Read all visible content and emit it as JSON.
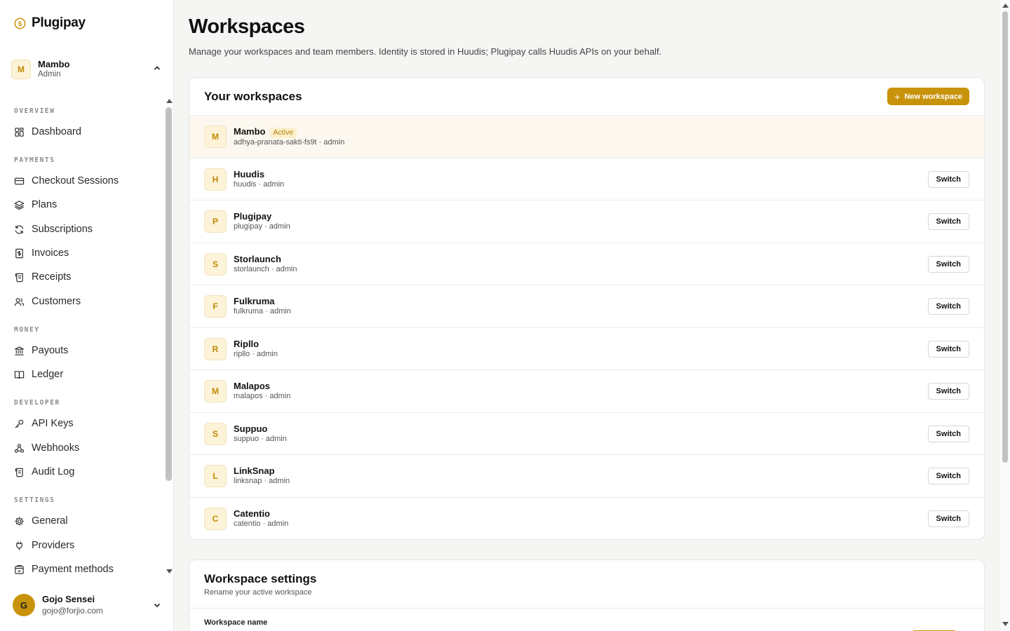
{
  "brand": {
    "name": "Plugipay",
    "accent": "#c8930a"
  },
  "workspace_switcher": {
    "initial": "M",
    "name": "Mambo",
    "role": "Admin"
  },
  "nav": {
    "sections": [
      {
        "label": "OVERVIEW",
        "items": [
          {
            "label": "Dashboard",
            "icon": "grid-icon"
          }
        ]
      },
      {
        "label": "PAYMENTS",
        "items": [
          {
            "label": "Checkout Sessions",
            "icon": "credit-card-icon"
          },
          {
            "label": "Plans",
            "icon": "layers-icon"
          },
          {
            "label": "Subscriptions",
            "icon": "refresh-icon"
          },
          {
            "label": "Invoices",
            "icon": "invoice-dollar-icon"
          },
          {
            "label": "Receipts",
            "icon": "scroll-icon"
          },
          {
            "label": "Customers",
            "icon": "users-icon"
          }
        ]
      },
      {
        "label": "MONEY",
        "items": [
          {
            "label": "Payouts",
            "icon": "bank-icon"
          },
          {
            "label": "Ledger",
            "icon": "book-icon"
          }
        ]
      },
      {
        "label": "DEVELOPER",
        "items": [
          {
            "label": "API Keys",
            "icon": "key-icon"
          },
          {
            "label": "Webhooks",
            "icon": "webhook-icon"
          },
          {
            "label": "Audit Log",
            "icon": "scroll-icon"
          }
        ]
      },
      {
        "label": "SETTINGS",
        "items": [
          {
            "label": "General",
            "icon": "gear-icon"
          },
          {
            "label": "Providers",
            "icon": "plug-icon"
          },
          {
            "label": "Payment methods",
            "icon": "wallet-icon"
          }
        ]
      }
    ]
  },
  "user": {
    "initial": "G",
    "name": "Gojo Sensei",
    "email": "gojo@forjio.com"
  },
  "header": {
    "title": "Workspaces",
    "subtitle": "Manage your workspaces and team members. Identity is stored in Huudis; Plugipay calls Huudis APIs on your behalf."
  },
  "workspaces_card": {
    "title": "Your workspaces",
    "new_button_label": "New workspace",
    "active_badge": "Active",
    "switch_label": "Switch",
    "rows": [
      {
        "initial": "M",
        "name": "Mambo",
        "meta": "adhya-pranata-sakti-fs9t · admin",
        "active": true
      },
      {
        "initial": "H",
        "name": "Huudis",
        "meta": "huudis · admin",
        "active": false
      },
      {
        "initial": "P",
        "name": "Plugipay",
        "meta": "plugipay · admin",
        "active": false
      },
      {
        "initial": "S",
        "name": "Storlaunch",
        "meta": "storlaunch · admin",
        "active": false
      },
      {
        "initial": "F",
        "name": "Fulkruma",
        "meta": "fulkruma · admin",
        "active": false
      },
      {
        "initial": "R",
        "name": "Ripllo",
        "meta": "ripllo · admin",
        "active": false
      },
      {
        "initial": "M",
        "name": "Malapos",
        "meta": "malapos · admin",
        "active": false
      },
      {
        "initial": "S",
        "name": "Suppuo",
        "meta": "suppuo · admin",
        "active": false
      },
      {
        "initial": "L",
        "name": "LinkSnap",
        "meta": "linksnap · admin",
        "active": false
      },
      {
        "initial": "C",
        "name": "Catentio",
        "meta": "catentio · admin",
        "active": false
      }
    ]
  },
  "settings_card": {
    "title": "Workspace settings",
    "subtitle": "Rename your active workspace",
    "field_label": "Workspace name"
  }
}
